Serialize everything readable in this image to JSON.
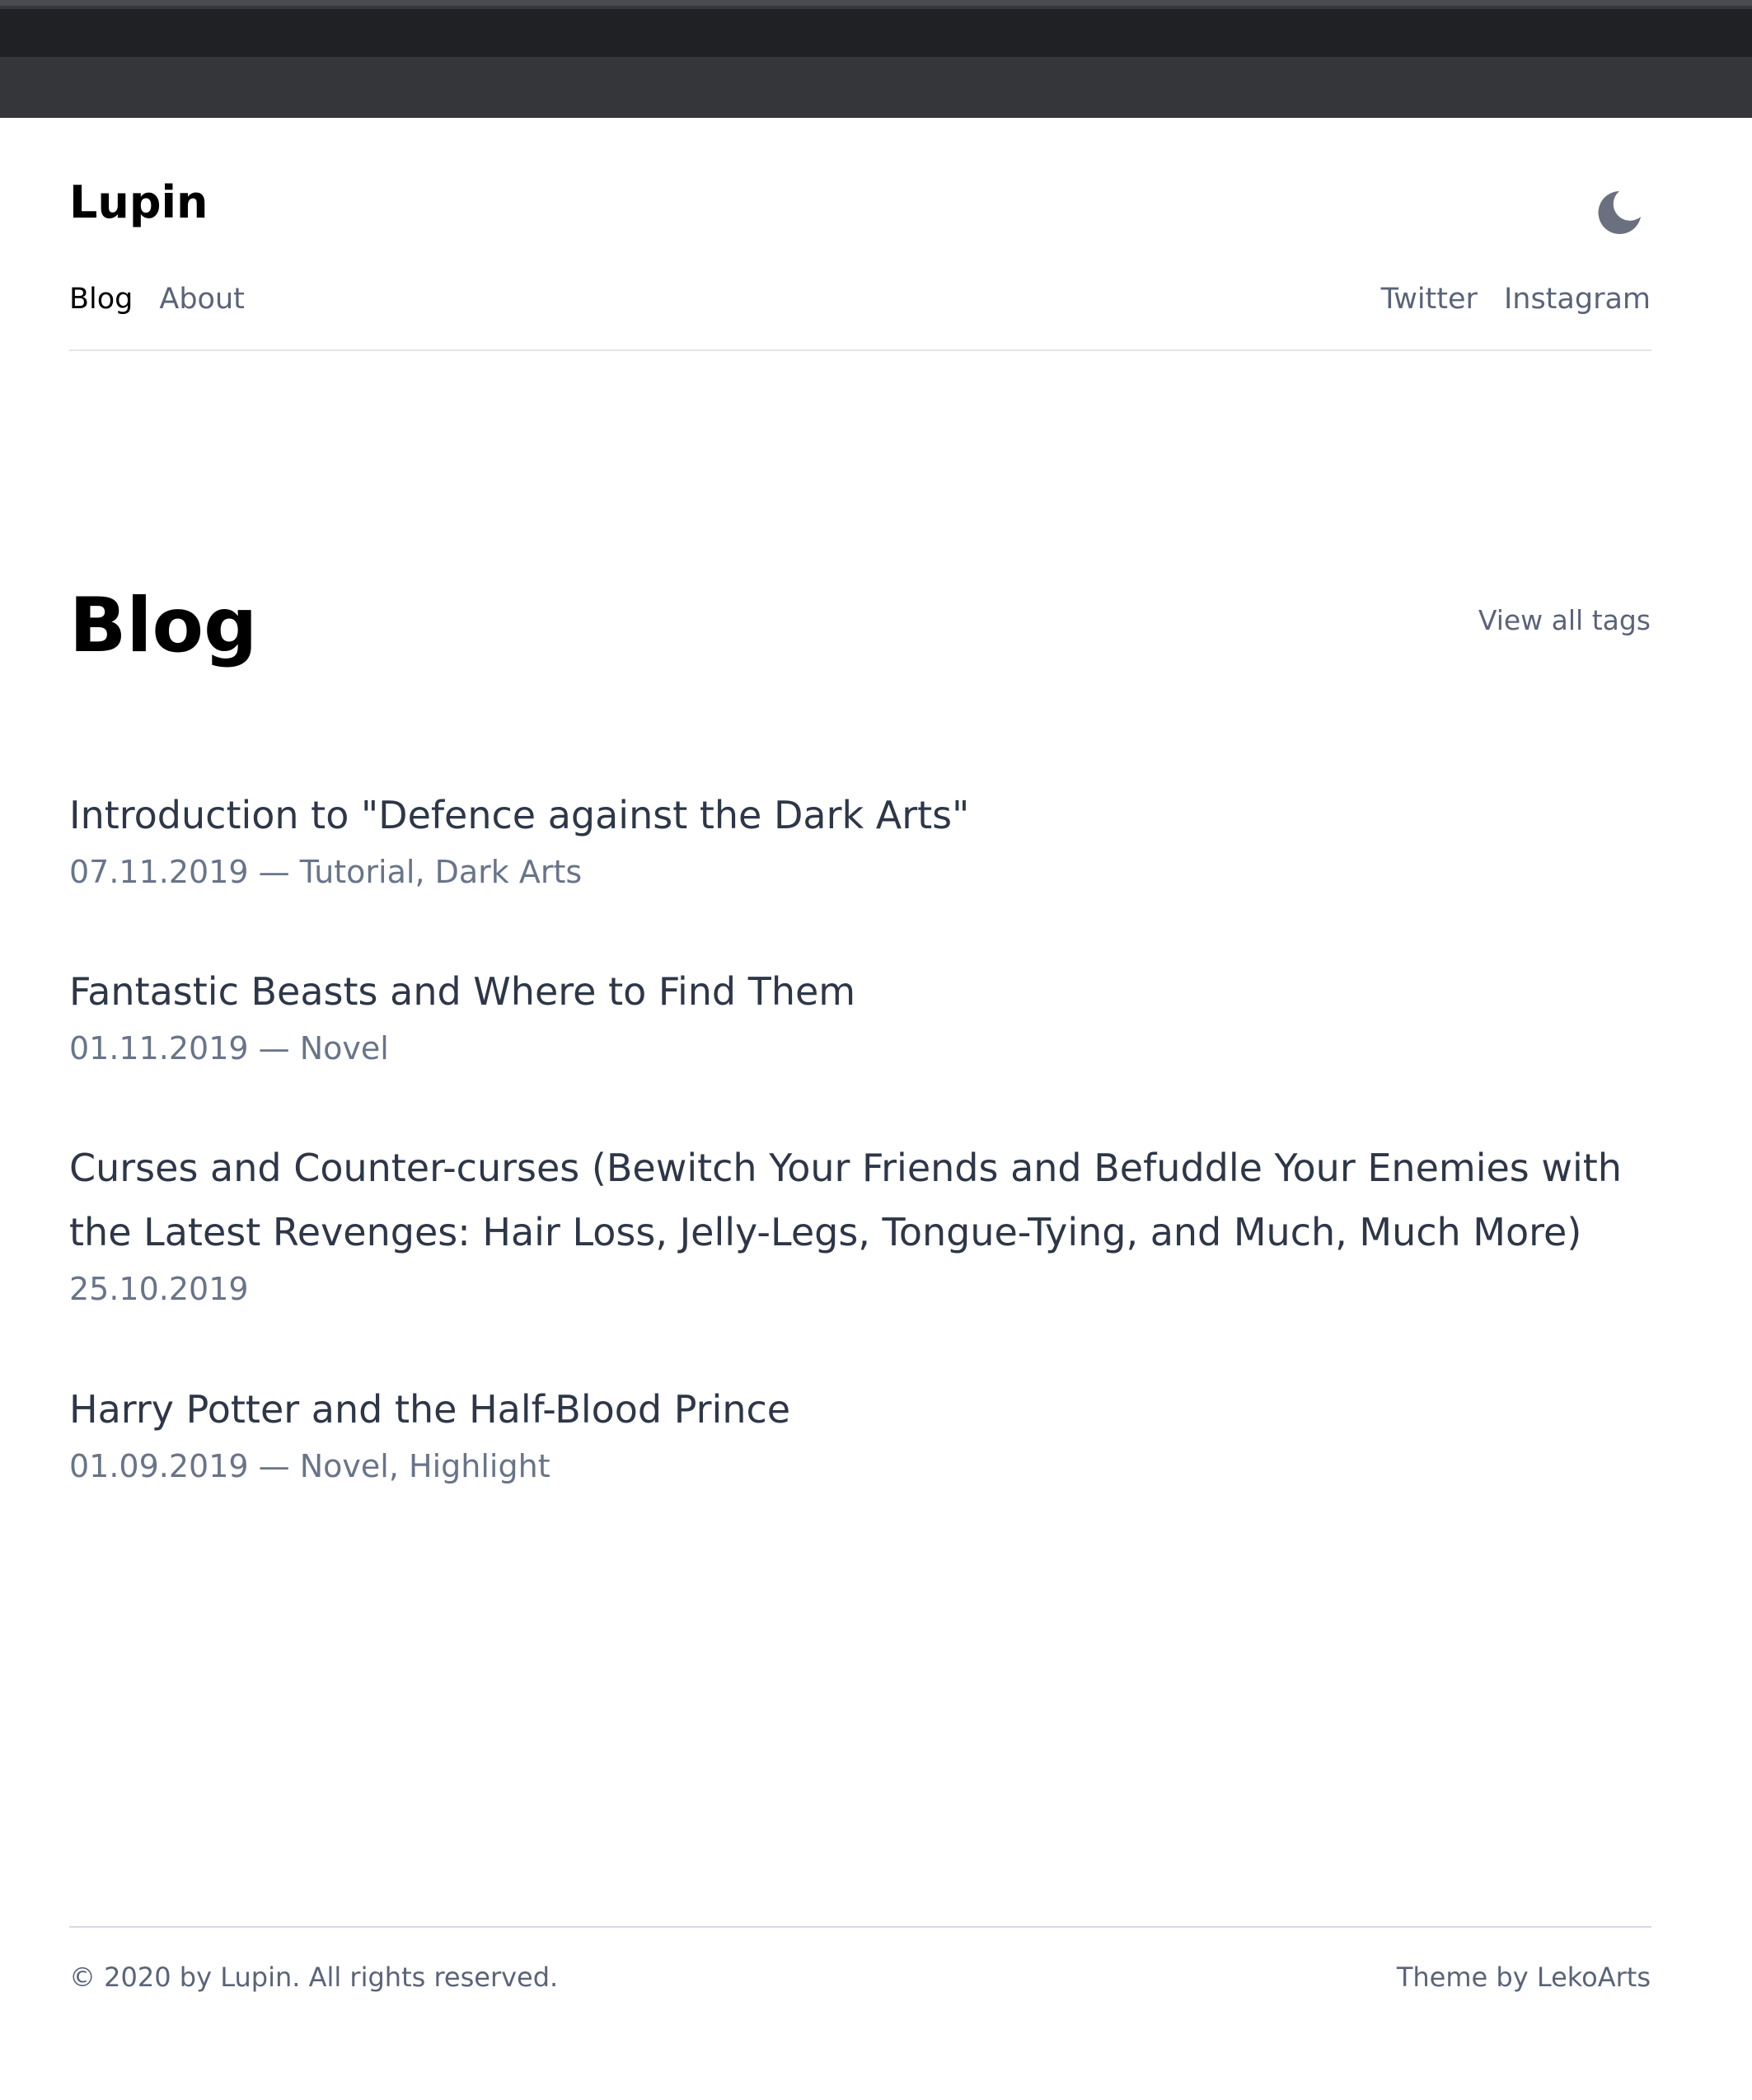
{
  "site": {
    "title": "Lupin"
  },
  "header": {
    "mode_toggle_icon": "moon-icon",
    "nav_left": [
      {
        "label": "Blog",
        "active": true
      },
      {
        "label": "About",
        "active": false
      }
    ],
    "nav_right": [
      {
        "label": "Twitter"
      },
      {
        "label": "Instagram"
      }
    ]
  },
  "main": {
    "heading": "Blog",
    "view_all_tags": "View all tags",
    "posts": [
      {
        "title": "Introduction to \"Defence against the Dark Arts\"",
        "date": "07.11.2019",
        "tags": [
          "Tutorial",
          "Dark Arts"
        ]
      },
      {
        "title": "Fantastic Beasts and Where to Find Them",
        "date": "01.11.2019",
        "tags": [
          "Novel"
        ]
      },
      {
        "title": "Curses and Counter-curses (Bewitch Your Friends and Befuddle Your Enemies with the Latest Revenges: Hair Loss, Jelly-Legs, Tongue-Tying, and Much, Much More)",
        "date": "25.10.2019",
        "tags": []
      },
      {
        "title": "Harry Potter and the Half-Blood Prince",
        "date": "01.09.2019",
        "tags": [
          "Novel",
          "Highlight"
        ]
      }
    ]
  },
  "footer": {
    "copyright": "© 2020 by Lupin. All rights reserved.",
    "theme_prefix": "Theme by ",
    "theme_link": "LekoArts"
  },
  "colors": {
    "text_primary": "#000000",
    "text_secondary": "#5a6478",
    "post_title": "#2d3748",
    "moon_icon": "#6b7080"
  }
}
